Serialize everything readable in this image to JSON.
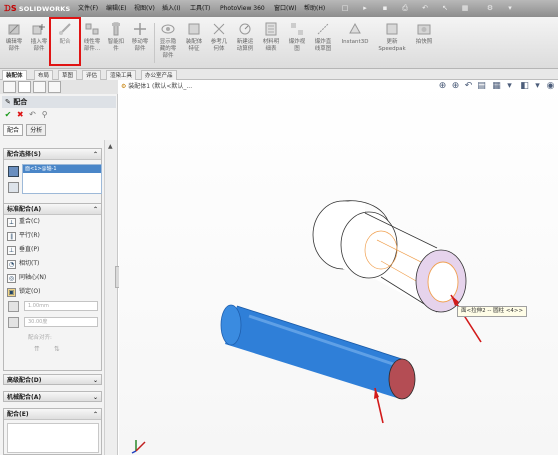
{
  "app": {
    "brand": "SOLIDWORKS",
    "menus": [
      "文件(F)",
      "编辑(E)",
      "视图(V)",
      "插入(I)",
      "工具(T)",
      "PhotoView 360",
      "窗口(W)",
      "帮助(H)"
    ]
  },
  "ribbon": {
    "buttons": [
      {
        "label": "编辑零\n部件",
        "icon": "edit-component-icon"
      },
      {
        "label": "插入零\n部件",
        "icon": "insert-component-icon"
      },
      {
        "label": "配合",
        "icon": "mate-icon"
      },
      {
        "label": "线性零\n部件...",
        "icon": "linear-pattern-icon"
      },
      {
        "label": "智能扣\n件",
        "icon": "smart-fastener-icon"
      },
      {
        "label": "移动零\n部件",
        "icon": "move-component-icon"
      },
      {
        "label": "显示隐\n藏的零\n部件",
        "icon": "show-hidden-icon"
      },
      {
        "label": "装配体\n特征",
        "icon": "assembly-feature-icon"
      },
      {
        "label": "参考几\n何体",
        "icon": "reference-geometry-icon"
      },
      {
        "label": "新建运\n动算例",
        "icon": "motion-study-icon"
      },
      {
        "label": "材料明\n细表",
        "icon": "bom-icon"
      },
      {
        "label": "爆炸视\n图",
        "icon": "explode-view-icon"
      },
      {
        "label": "爆炸直\n线草图",
        "icon": "explode-line-icon"
      },
      {
        "label": "Instant3D",
        "icon": "instant3d-icon"
      },
      {
        "label": "更新\nSpeedpak",
        "icon": "speedpak-icon"
      },
      {
        "label": "拍快照",
        "icon": "snapshot-icon"
      }
    ]
  },
  "tabs": [
    "装配体",
    "布局",
    "草图",
    "评估",
    "渲染工具",
    "办公室产品"
  ],
  "tree_path": "装配体1 (默认<默认_...",
  "property_manager": {
    "title": "配合",
    "subtabs": [
      "配合",
      "分析"
    ],
    "selections_header": "配合选择(S)",
    "selected_item": "面<1>@轴-1",
    "standard_header": "标准配合(A)",
    "mates": [
      "重合(C)",
      "平行(R)",
      "垂直(P)",
      "相切(T)",
      "同轴心(N)",
      "锁定(O)"
    ],
    "distance_value": "1.00mm",
    "angle_value": "30.00度",
    "alignment_label": "配合对齐:",
    "advanced_header": "高级配合(D)",
    "mechanical_header": "机械配合(A)",
    "mates_list_header": "配合(E)"
  },
  "callout": "面<拉伸2 -- 圆柱 <4>>",
  "colors": {
    "shaft": "#2f7fd8",
    "shaft_end": "#b44d54",
    "bushing_face": "#e6d3ec",
    "highlight": "#e01414"
  }
}
